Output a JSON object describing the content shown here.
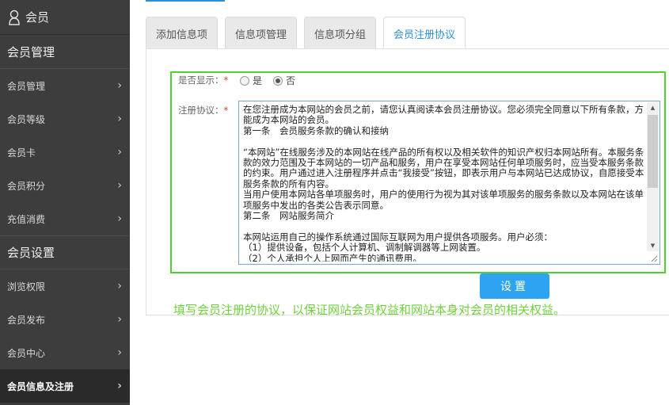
{
  "sidebar": {
    "title": "会员",
    "group1": "会员管理",
    "group1_items": [
      "会员管理",
      "会员等级",
      "会员卡",
      "会员积分",
      "充值消费"
    ],
    "group2": "会员设置",
    "group2_items": [
      "浏览权限",
      "会员发布",
      "会员中心",
      "会员信息及注册"
    ],
    "chevron": "›"
  },
  "tabs": [
    "添加信息项",
    "信息项管理",
    "信息项分组",
    "会员注册协议"
  ],
  "form": {
    "display_label": "是否显示：",
    "required_mark": "*",
    "radio_yes": "是",
    "radio_no": "否",
    "radio_selected": "否",
    "agreement_label": "注册协议：",
    "agreement_text": "在您注册成为本网站的会员之前，请您认真阅读本会员注册协议。您必须完全同意以下所有条款，方能成为本网站的会员。\n第一条　会员服务条款的确认和接纳\n\n“本网站”在线服务涉及的本网站在线产品的所有权以及相关软件的知识产权归本网站所有。本服务条款的效力范围及于本网站的一切产品和服务，用户在享受本网站任何单项服务时，应当受本服务条款的约束。用户通过进入注册程序并点击“我接受”按钮，即表示用户与本网站已达成协议，自愿接受本服务条款的所有内容。\n当用户使用本网站各单项服务时，用户的使用行为视为其对该单项服务的服务条款以及本网站在该单项服务中发出的各类公告表示同意。\n第二条　网站服务简介\n\n本网站运用自己的操作系统通过国际互联网为用户提供各项服务。用户必须：\n（1）提供设备，包括个人计算机、调制解调器等上网装置。\n（2）个人承担个人上网而产生的通讯费用。",
    "submit_label": "设置"
  },
  "note": "填写会员注册的协议，以保证网站会员权益和网站本身对会员的相关权益。",
  "colors": {
    "accent": "#2d8fd9",
    "button": "#2ea3f2",
    "highlight": "#4fd12f",
    "note": "#6fd13c",
    "sidebar": "#3d3d3d"
  }
}
